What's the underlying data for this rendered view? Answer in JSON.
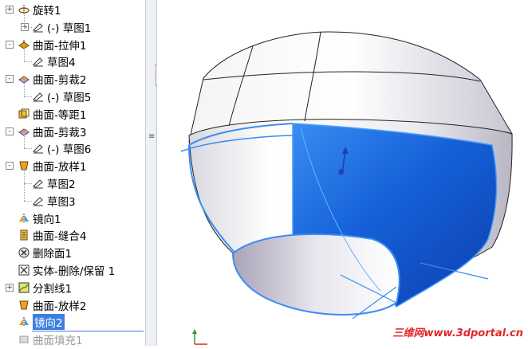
{
  "feature_tree": {
    "items": [
      {
        "label": "旋转1",
        "icon": "revolve-icon",
        "indent": 0,
        "expander": "+",
        "state": "normal"
      },
      {
        "label": "(-) 草图1",
        "icon": "sketch-icon",
        "indent": 1,
        "expander": "+",
        "state": "normal"
      },
      {
        "label": "曲面-拉伸1",
        "icon": "surface-extrude-icon",
        "indent": 0,
        "expander": "-",
        "state": "normal"
      },
      {
        "label": "草图4",
        "icon": "sketch-icon",
        "indent": 1,
        "expander": "",
        "state": "normal"
      },
      {
        "label": "曲面-剪裁2",
        "icon": "surface-trim-icon",
        "indent": 0,
        "expander": "-",
        "state": "normal"
      },
      {
        "label": "(-) 草图5",
        "icon": "sketch-icon",
        "indent": 1,
        "expander": "",
        "state": "normal"
      },
      {
        "label": "曲面-等距1",
        "icon": "surface-offset-icon",
        "indent": 0,
        "expander": "",
        "state": "normal"
      },
      {
        "label": "曲面-剪裁3",
        "icon": "surface-trim-icon",
        "indent": 0,
        "expander": "-",
        "state": "normal"
      },
      {
        "label": "(-) 草图6",
        "icon": "sketch-icon",
        "indent": 1,
        "expander": "",
        "state": "normal"
      },
      {
        "label": "曲面-放样1",
        "icon": "surface-loft-icon",
        "indent": 0,
        "expander": "-",
        "state": "normal"
      },
      {
        "label": "草图2",
        "icon": "sketch-icon",
        "indent": 1,
        "expander": "",
        "state": "normal"
      },
      {
        "label": "草图3",
        "icon": "sketch-icon",
        "indent": 1,
        "expander": "",
        "state": "normal"
      },
      {
        "label": "镜向1",
        "icon": "mirror-icon",
        "indent": 0,
        "expander": "",
        "state": "normal"
      },
      {
        "label": "曲面-缝合4",
        "icon": "surface-knit-icon",
        "indent": 0,
        "expander": "",
        "state": "normal"
      },
      {
        "label": "删除面1",
        "icon": "delete-face-icon",
        "indent": 0,
        "expander": "",
        "state": "normal"
      },
      {
        "label": "实体-删除/保留 1",
        "icon": "body-delete-icon",
        "indent": 0,
        "expander": "",
        "state": "normal"
      },
      {
        "label": "分割线1",
        "icon": "split-line-icon",
        "indent": 0,
        "expander": "+",
        "state": "normal"
      },
      {
        "label": "曲面-放样2",
        "icon": "surface-loft-icon",
        "indent": 0,
        "expander": "",
        "state": "normal"
      },
      {
        "label": "镜向2",
        "icon": "mirror-icon",
        "indent": 0,
        "expander": "",
        "state": "selected"
      },
      {
        "label": "曲面填充1",
        "icon": "surface-fill-icon",
        "indent": 0,
        "expander": "",
        "state": "faded"
      }
    ]
  },
  "splitter": {
    "handle_glyph": "‹‹‹",
    "sash_glyph": "≡"
  },
  "watermark": {
    "text": "三维网www.3dportal.cn"
  },
  "colors": {
    "selection": "#3d7fe0",
    "model_highlight": "#1e6ee6",
    "model_surface": "#ffffff",
    "watermark": "#e0262b"
  }
}
